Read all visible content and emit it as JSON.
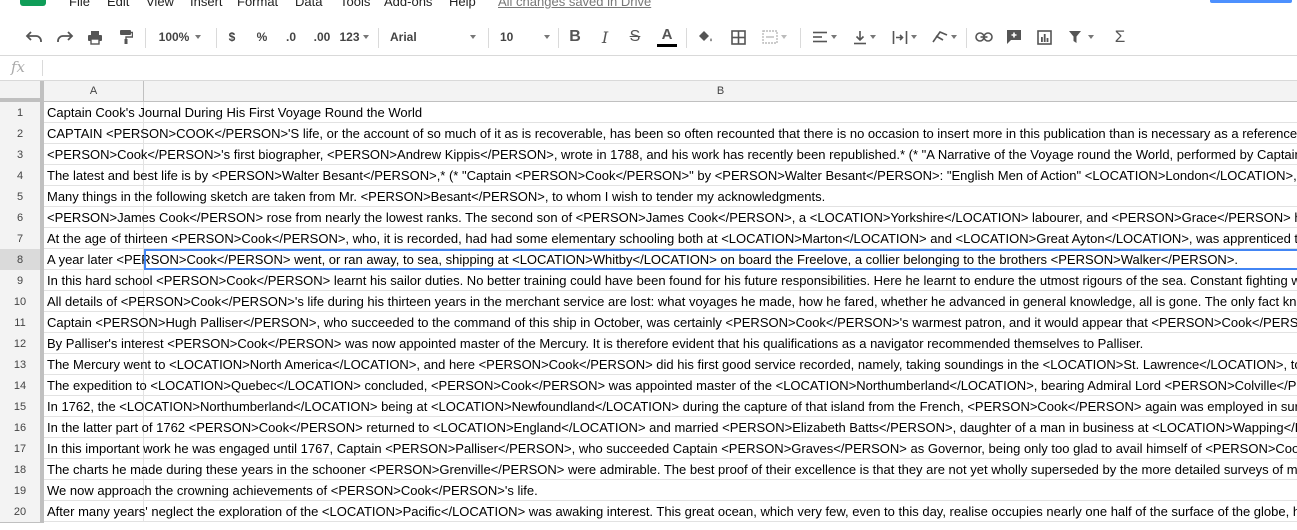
{
  "menu": {
    "items": [
      "File",
      "Edit",
      "View",
      "Insert",
      "Format",
      "Data",
      "Tools",
      "Add-ons",
      "Help"
    ],
    "saved_status": "All changes saved in Drive"
  },
  "toolbar": {
    "zoom": "100%",
    "currency": "$",
    "percent": "%",
    "decrease_decimal": ".0",
    "increase_decimal": ".00",
    "more_formats": "123",
    "font_family": "Arial",
    "font_size": "10"
  },
  "formula_bar": {
    "fx_label": "fx",
    "value": ""
  },
  "columns": [
    "A",
    "B"
  ],
  "selected_row": 8,
  "rows": [
    {
      "num": "1",
      "text": "Captain Cook's Journal During His First Voyage Round the World"
    },
    {
      "num": "2",
      "text": "CAPTAIN <PERSON>COOK</PERSON>'S life, or the account of so much of it as is recoverable, has been so often recounted that there is no occasion to insert more in this publication than is necessary as a reference"
    },
    {
      "num": "3",
      "text": "<PERSON>Cook</PERSON>'s first biographer, <PERSON>Andrew Kippis</PERSON>, wrote in 1788, and his work has recently been republished.* (* \"A Narrative of the Voyage round the World, performed by Captain"
    },
    {
      "num": "4",
      "text": "The latest and best life is by <PERSON>Walter Besant</PERSON>,* (* \"Captain <PERSON>Cook</PERSON>\" by <PERSON>Walter Besant</PERSON>: \"English Men of Action\" <LOCATION>London</LOCATION>,"
    },
    {
      "num": "5",
      "text": "Many things in the following sketch are taken from Mr. <PERSON>Besant</PERSON>, to whom I wish to tender my acknowledgments."
    },
    {
      "num": "6",
      "text": "<PERSON>James Cook</PERSON> rose from nearly the lowest ranks. The second son of <PERSON>James Cook</PERSON>, a <LOCATION>Yorkshire</LOCATION> labourer, and <PERSON>Grace</PERSON> h"
    },
    {
      "num": "7",
      "text": "At the age of thirteen <PERSON>Cook</PERSON>, who, it is recorded, had had some elementary schooling both at <LOCATION>Marton</LOCATION> and <LOCATION>Great Ayton</LOCATION>, was apprenticed t"
    },
    {
      "num": "8",
      "text": "A year later <PERSON>Cook</PERSON> went, or ran away, to sea, shipping at <LOCATION>Whitby</LOCATION> on board the Freelove, a collier belonging to the brothers <PERSON>Walker</PERSON>."
    },
    {
      "num": "9",
      "text": "In this hard school <PERSON>Cook</PERSON> learnt his sailor duties. No better training could have been found for his future responsibilities. Here he learnt to endure the utmost rigours of the sea. Constant fighting w"
    },
    {
      "num": "10",
      "text": "All details of <PERSON>Cook</PERSON>'s life during his thirteen years in the merchant service are lost: what voyages he made, how he fared, whether he advanced in general knowledge, all is gone. The only fact kn"
    },
    {
      "num": "11",
      "text": "Captain <PERSON>Hugh Palliser</PERSON>, who succeeded to the command of this ship in October, was certainly <PERSON>Cook</PERSON>'s warmest patron, and it would appear that <PERSON>Cook</PERSON"
    },
    {
      "num": "12",
      "text": "By Palliser's interest <PERSON>Cook</PERSON> was now appointed master of the Mercury. It is therefore evident that his qualifications as a navigator recommended themselves to Palliser."
    },
    {
      "num": "13",
      "text": "The Mercury went to <LOCATION>North America</LOCATION>, and here <PERSON>Cook</PERSON> did his first good service recorded, namely, taking soundings in the <LOCATION>St. Lawrence</LOCATION>, to"
    },
    {
      "num": "14",
      "text": "The expedition to <LOCATION>Quebec</LOCATION> concluded, <PERSON>Cook</PERSON> was appointed master of the <LOCATION>Northumberland</LOCATION>, bearing Admiral Lord <PERSON>Colville</P"
    },
    {
      "num": "15",
      "text": "In 1762, the <LOCATION>Northumberland</LOCATION> being at <LOCATION>Newfoundland</LOCATION> during the capture of that island from the French, <PERSON>Cook</PERSON> again was employed in sur"
    },
    {
      "num": "16",
      "text": "In the latter part of 1762 <PERSON>Cook</PERSON> returned to <LOCATION>England</LOCATION> and married <PERSON>Elizabeth Batts</PERSON>, daughter of a man in business at <LOCATION>Wapping</L"
    },
    {
      "num": "17",
      "text": "In this important work he was engaged until 1767, Captain <PERSON>Palliser</PERSON>, who succeeded Captain <PERSON>Graves</PERSON> as Governor, being only too glad to avail himself of <PERSON>Coo"
    },
    {
      "num": "18",
      "text": "The charts he made during these years in the schooner <PERSON>Grenville</PERSON> were admirable. The best proof of their excellence is that they are not yet wholly superseded by the more detailed surveys of m"
    },
    {
      "num": "19",
      "text": "We now approach the crowning achievements of <PERSON>Cook</PERSON>'s life."
    },
    {
      "num": "20",
      "text": "After many years' neglect the exploration of the <LOCATION>Pacific</LOCATION> was awaking interest. This great ocean, which very few, even to this day, realise occupies nearly one half of the surface of the globe, h"
    }
  ]
}
